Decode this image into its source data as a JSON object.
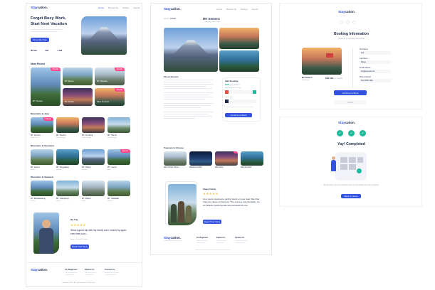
{
  "brand": {
    "prefix": "Stay",
    "suffix": "cation."
  },
  "frame1": {
    "nav": [
      "Home",
      "Browse by",
      "Stories",
      "Agents"
    ],
    "hero_title_1": "Forget Busy Work,",
    "hero_title_2": "Start Next Vacation",
    "hero_button": "Show Me Now",
    "stats": [
      "80,409",
      "862",
      "1,492"
    ],
    "most_picked": {
      "title": "Most Picked",
      "items": [
        {
          "name": "MT. Semeru",
          "loc": "Jawa Timur",
          "tag": "Popular"
        },
        {
          "name": "MT. Bromo",
          "loc": "Jawa Timur",
          "tag": ""
        },
        {
          "name": "MT. Merbabu",
          "loc": "Jawa Tengah",
          "tag": "Popular"
        },
        {
          "name": "MT. Rinjani",
          "loc": "NTB",
          "tag": ""
        },
        {
          "name": "Ranu Kumbolo",
          "loc": "Jawa Timur",
          "tag": "Popular"
        }
      ]
    },
    "rows": [
      {
        "title": "Mountains In Java",
        "items": [
          {
            "name": "MT. Semeru",
            "loc": "Jawa Timur",
            "tag": "Popular"
          },
          {
            "name": "MT. Sindoro",
            "loc": "Jawa Tengah",
            "tag": ""
          },
          {
            "name": "MT. Sumbing",
            "loc": "Jawa Tengah",
            "tag": ""
          },
          {
            "name": "MT. Slamet",
            "loc": "Jawa Tengah",
            "tag": ""
          }
        ]
      },
      {
        "title": "Mountains In Sumatera",
        "items": [
          {
            "name": "MT. Kerinci",
            "loc": "Jambi",
            "tag": ""
          },
          {
            "name": "MT. Singgalang",
            "loc": "Sumbar",
            "tag": ""
          },
          {
            "name": "MT. Talang",
            "loc": "Sumbar",
            "tag": ""
          },
          {
            "name": "MT. Leuser",
            "loc": "Aceh",
            "tag": "Popular"
          }
        ]
      },
      {
        "title": "Mountains In Sulawesi",
        "items": [
          {
            "name": "MT. Bawakaraeng",
            "loc": "Sulsel",
            "tag": ""
          },
          {
            "name": "MT. Latimojong",
            "loc": "Sulsel",
            "tag": ""
          },
          {
            "name": "MT. Klabat",
            "loc": "Sulut",
            "tag": ""
          },
          {
            "name": "MT. Nokilalaki",
            "loc": "Sulteng",
            "tag": ""
          }
        ]
      }
    ],
    "testimonial": {
      "label": "My Trip",
      "quote": "What a great trip with my family and I should try again next time soon ...",
      "author": "Angga, Product Designer",
      "button": "Read Their Story"
    },
    "footer": {
      "cols": [
        "For Beginners",
        "Explore Us",
        "Connect Us"
      ],
      "copyright": "Copyright 2019 • All rights reserved • Staycation"
    }
  },
  "frame2": {
    "nav": [
      "Home",
      "Browse by",
      "Stories",
      "Agents"
    ],
    "breadcrumb": [
      "Home",
      "Details"
    ],
    "title": "MT Semeru",
    "location": "Lumajang, Jawa Timur",
    "about_title": "About Semeru",
    "start_booking": {
      "title": "Start Booking",
      "price": "$280",
      "per": "per person",
      "label1": "How long you will stay?",
      "label2": "Pick a date",
      "button": "Continue to Book"
    },
    "treasure_title": "Treasure to Choose",
    "treasures": [
      {
        "name": "Ranu Tompe Terrace"
      },
      {
        "name": "Mahameru Paths"
      },
      {
        "name": "Ranu Pane"
      },
      {
        "name": "Ranu Kumbolo"
      }
    ],
    "testimonial": {
      "label": "Happy Family",
      "quote": "As a good experience getting stuck on your dear hike that hopes to dream of Semeru. The scenery was fantastic. Go at a hidden global gentle time beneath the top.",
      "button": "Read Their Story"
    },
    "footer": {
      "cols": [
        "For Beginners",
        "Explore Us",
        "Connect Us"
      ]
    }
  },
  "frame3": {
    "title": "Booking Information",
    "subtitle": "Please fill up the blank fields below",
    "trip_name": "MT. Semeru",
    "trip_loc": "Lumajang",
    "total": "$280 USD",
    "per": "per 2 nights",
    "fields": [
      {
        "label": "First Name",
        "value": "Ardi"
      },
      {
        "label": "Last Name",
        "value": "Wijaya"
      },
      {
        "label": "Email Address",
        "value": "ardi@staycation.id"
      },
      {
        "label": "Phone Number",
        "value": "0812 3456 7890"
      }
    ],
    "continue": "Continue to Book",
    "cancel": "Cancel"
  },
  "frame4": {
    "title": "Yay! Completed",
    "note": "We will inform you via email later once the transaction has been accepted",
    "button": "Back to Home"
  },
  "colors": {
    "accent": "#3252df",
    "navy": "#1e2a4a",
    "tag": "#ff498b",
    "star": "#f7c845",
    "success": "#1abc9c"
  }
}
